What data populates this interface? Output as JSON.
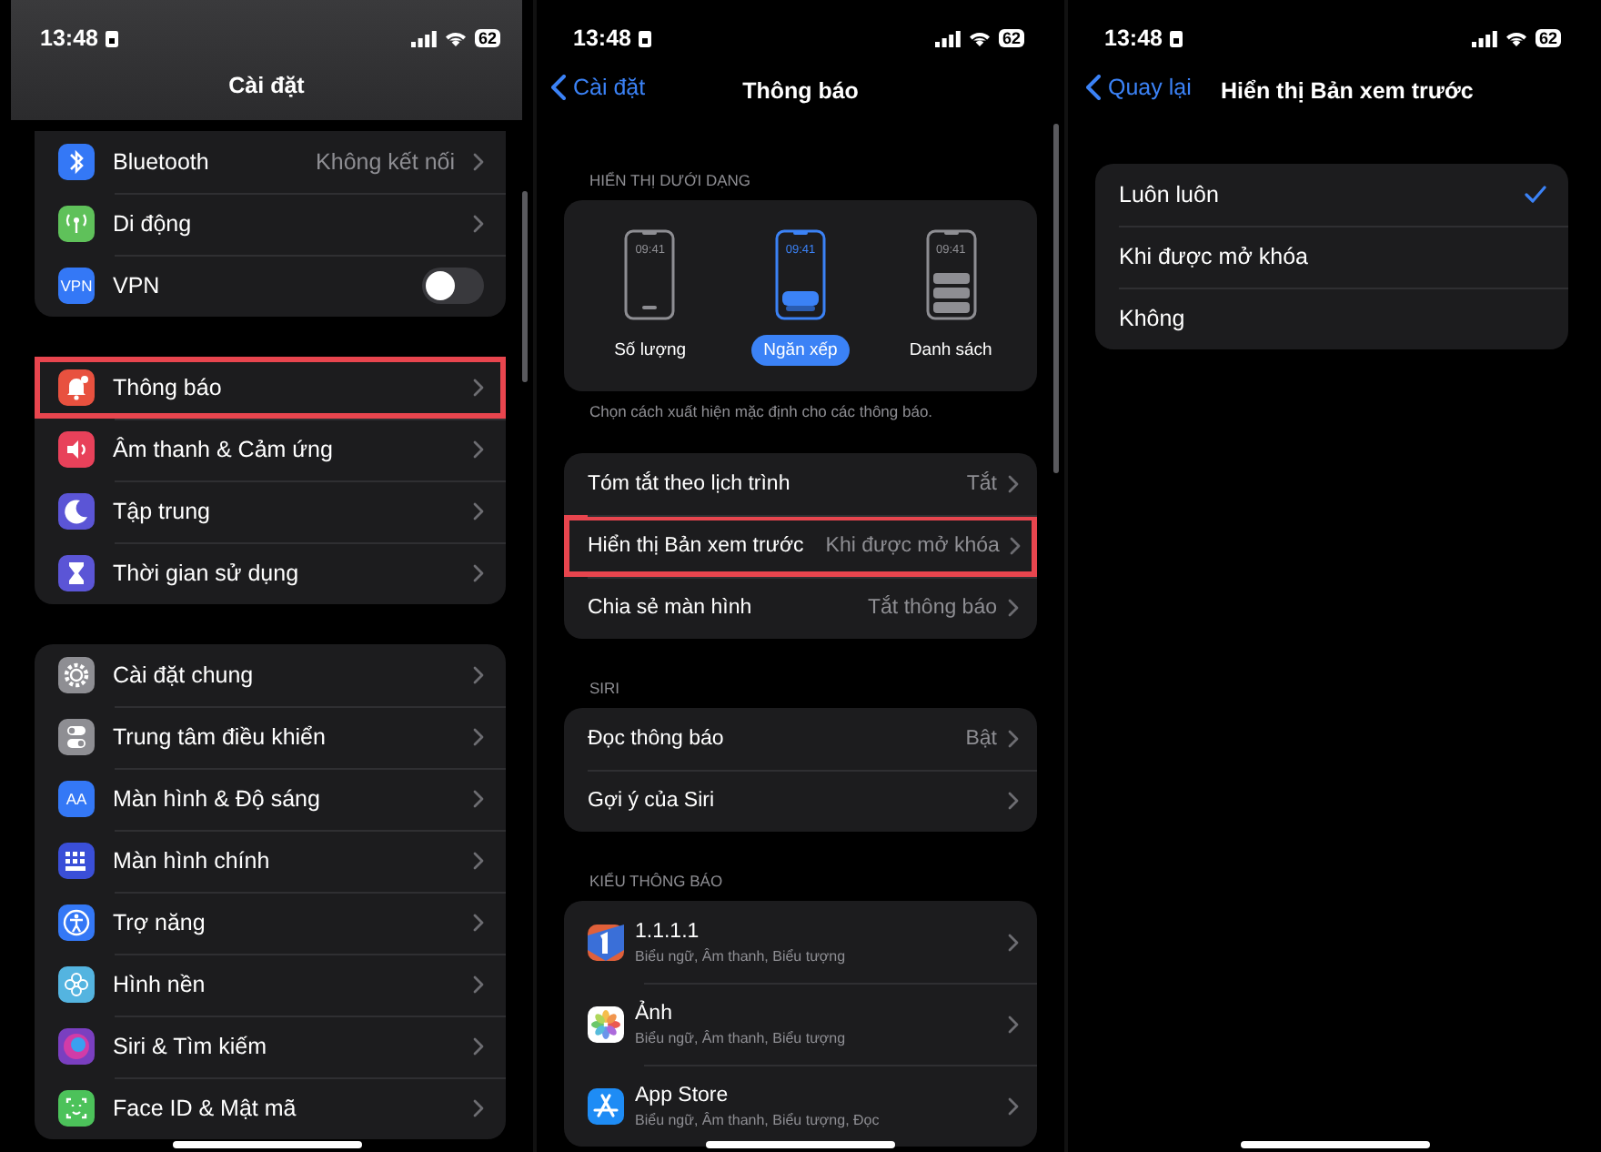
{
  "screens": [
    {
      "kind": "settings",
      "status_bar": {
        "time": "13:48",
        "battery": "62"
      },
      "title": "Cài đặt",
      "groups": [
        {
          "rows": [
            {
              "kind": "link",
              "label": "Bluetooth",
              "value": "Không kết nối",
              "color": "#3478f6",
              "highlighted": false
            },
            {
              "kind": "link",
              "label": "Di động",
              "color": "#5fc15a",
              "highlighted": false
            },
            {
              "kind": "toggle",
              "label": "VPN",
              "icon_text": "VPN",
              "color": "#3478f6",
              "on": false,
              "highlighted": false
            }
          ]
        },
        {
          "rows": [
            {
              "kind": "link",
              "label": "Thông báo",
              "color": "#e8513f",
              "highlighted": true
            },
            {
              "kind": "link",
              "label": "Âm thanh & Cảm ứng",
              "color": "#e8415a",
              "highlighted": false
            },
            {
              "kind": "link",
              "label": "Tập trung",
              "color": "#5b55d6",
              "highlighted": false
            },
            {
              "kind": "link",
              "label": "Thời gian sử dụng",
              "color": "#5b55d6",
              "highlighted": false
            }
          ]
        },
        {
          "rows": [
            {
              "kind": "link",
              "label": "Cài đặt chung",
              "color": "#8e8e93",
              "highlighted": false
            },
            {
              "kind": "link",
              "label": "Trung tâm điều khiển",
              "color": "#8e8e93",
              "highlighted": false
            },
            {
              "kind": "link",
              "label": "Màn hình & Độ sáng",
              "icon_text": "AA",
              "color": "#3478f6",
              "highlighted": false
            },
            {
              "kind": "link",
              "label": "Màn hình chính",
              "color": "#3a4fd8",
              "highlighted": false
            },
            {
              "kind": "link",
              "label": "Trợ năng",
              "color": "#3478f6",
              "highlighted": false
            },
            {
              "kind": "link",
              "label": "Hình nền",
              "color": "#54b4e0",
              "highlighted": false
            },
            {
              "kind": "link",
              "label": "Siri & Tìm kiếm",
              "color": "#7a3fc0",
              "highlighted": false
            },
            {
              "kind": "link",
              "label": "Face ID & Mật mã",
              "color": "#4cc25a",
              "highlighted": false
            }
          ]
        }
      ]
    },
    {
      "kind": "notifications",
      "status_bar": {
        "time": "13:48",
        "battery": "62"
      },
      "back": "Cài đặt",
      "title": "Thông báo",
      "display_section": {
        "header": "HIỂN THỊ DƯỚI DẠNG",
        "footer": "Chọn cách xuất hiện mặc định cho các thông báo.",
        "options": [
          {
            "kind": "count",
            "clock": "09:41",
            "label": "Số lượng",
            "selected": false
          },
          {
            "kind": "stack",
            "clock": "09:41",
            "label": "Ngăn xếp",
            "selected": true
          },
          {
            "kind": "list",
            "clock": "09:41",
            "label": "Danh sách",
            "selected": false
          }
        ]
      },
      "groups": [
        {
          "rows": [
            {
              "kind": "link",
              "label": "Tóm tắt theo lịch trình",
              "value": "Tắt",
              "highlighted": false
            },
            {
              "kind": "link",
              "label": "Hiển thị Bản xem trước",
              "value": "Khi được mở khóa",
              "highlighted": true
            },
            {
              "kind": "link",
              "label": "Chia sẻ màn hình",
              "value": "Tắt thông báo",
              "highlighted": false
            }
          ]
        },
        {
          "header": "SIRI",
          "rows": [
            {
              "kind": "link",
              "label": "Đọc thông báo",
              "value": "Bật",
              "highlighted": false
            },
            {
              "kind": "link",
              "label": "Gợi ý của Siri",
              "highlighted": false
            }
          ]
        },
        {
          "header": "KIỂU THÔNG BÁO",
          "rows": [
            {
              "kind": "app",
              "label": "1.1.1.1",
              "subtitle": "Biểu ngữ, Âm thanh, Biểu tượng",
              "color": "#e0603a",
              "highlighted": false
            },
            {
              "kind": "app",
              "label": "Ảnh",
              "subtitle": "Biểu ngữ, Âm thanh, Biểu tượng",
              "color": "#ffffff",
              "highlighted": false
            },
            {
              "kind": "app",
              "label": "App Store",
              "subtitle": "Biểu ngữ, Âm thanh, Biểu tượng, Đọc",
              "color": "#1e8cf5",
              "highlighted": false
            }
          ]
        }
      ]
    },
    {
      "kind": "preview",
      "status_bar": {
        "time": "13:48",
        "battery": "62"
      },
      "back": "Quay lại",
      "title": "Hiển thị Bản xem trước",
      "options": [
        {
          "label": "Luôn luôn",
          "selected": true
        },
        {
          "label": "Khi được mở khóa",
          "selected": false
        },
        {
          "label": "Không",
          "selected": false
        }
      ]
    }
  ]
}
